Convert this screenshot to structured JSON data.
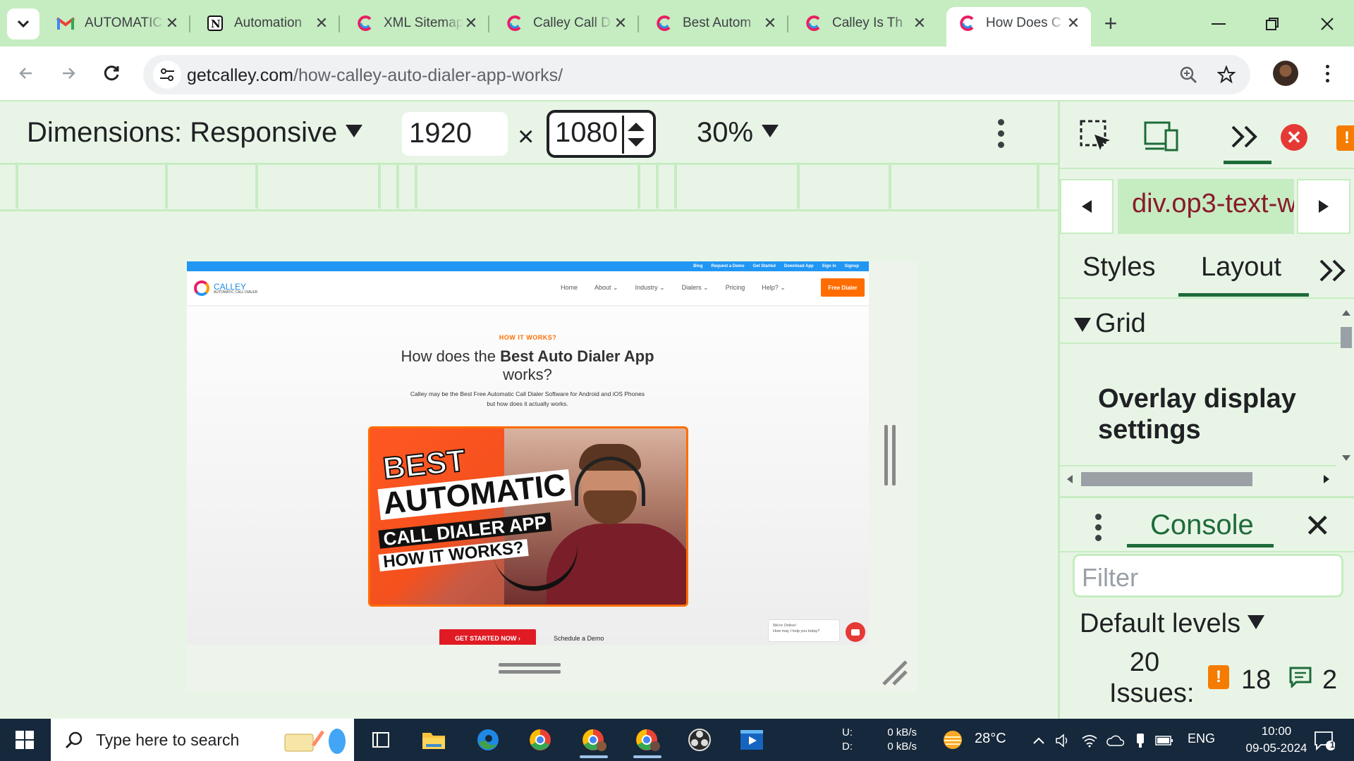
{
  "browser": {
    "tabs": [
      {
        "title": "AUTOMATIC",
        "icon": "gmail-icon"
      },
      {
        "title": "Automation",
        "icon": "notion-icon"
      },
      {
        "title": "XML Sitemap",
        "icon": "calley-icon"
      },
      {
        "title": "Calley Call D",
        "icon": "calley-icon"
      },
      {
        "title": "Best Autom",
        "icon": "calley-icon"
      },
      {
        "title": "Calley Is Th",
        "icon": "calley-icon"
      },
      {
        "title": "How Does C",
        "icon": "calley-icon",
        "active": true
      }
    ],
    "new_tab": "+",
    "url_host": "getcalley.com",
    "url_path": "/how-calley-auto-dialer-app-works/"
  },
  "device_toolbar": {
    "dimensions_label": "Dimensions: Responsive",
    "width": "1920",
    "times": "×",
    "height": "1080",
    "zoom": "30%"
  },
  "site": {
    "topbar_links": [
      "Blog",
      "Request a Demo",
      "Get Started",
      "Download App",
      "Sign in",
      "Signup"
    ],
    "logo_name": "CALLEY",
    "logo_tagline": "AUTOMATIC CALL DIALER",
    "nav": [
      "Home",
      "About ⌄",
      "Industry ⌄",
      "Dialers ⌄",
      "Pricing",
      "Help? ⌄"
    ],
    "cta_top": "Free Dialer",
    "eyebrow": "HOW IT WORKS?",
    "headline_pre": "How does the ",
    "headline_bold": "Best Auto Dialer App",
    "headline_post": " works?",
    "subtext": "Calley may be the Best Free Automatic Call Dialer Software for Android and iOS Phones but how does it actually works.",
    "thumbnail_lines": [
      "BEST",
      "AUTOMATIC",
      "CALL DIALER APP",
      "HOW IT WORKS?"
    ],
    "cta_primary": "GET STARTED NOW ›",
    "cta_secondary": "Schedule a Demo",
    "chat_line1": "We're Online!",
    "chat_line2": "How may I help you today?"
  },
  "devtools": {
    "breadcrumb": "div.op3-text-w",
    "panel_tabs": [
      "Styles",
      "Layout"
    ],
    "section_title": "Grid",
    "overlay_title": "Overlay display settings",
    "console_tab": "Console",
    "filter_placeholder": "Filter",
    "levels": "Default levels",
    "issues_count": "20",
    "issues_label": "Issues:",
    "warn_count": "18",
    "msg_count": "2",
    "colors": {
      "accent": "#1e6b3a",
      "error": "#e53935",
      "warning": "#f57c00"
    }
  },
  "taskbar": {
    "search_placeholder": "Type here to search",
    "net_up_label": "U:",
    "net_down_label": "D:",
    "net_up": "0 kB/s",
    "net_down": "0 kB/s",
    "temperature": "28°C",
    "language": "ENG",
    "time": "10:00",
    "date": "09-05-2024",
    "notification_count": "1"
  }
}
